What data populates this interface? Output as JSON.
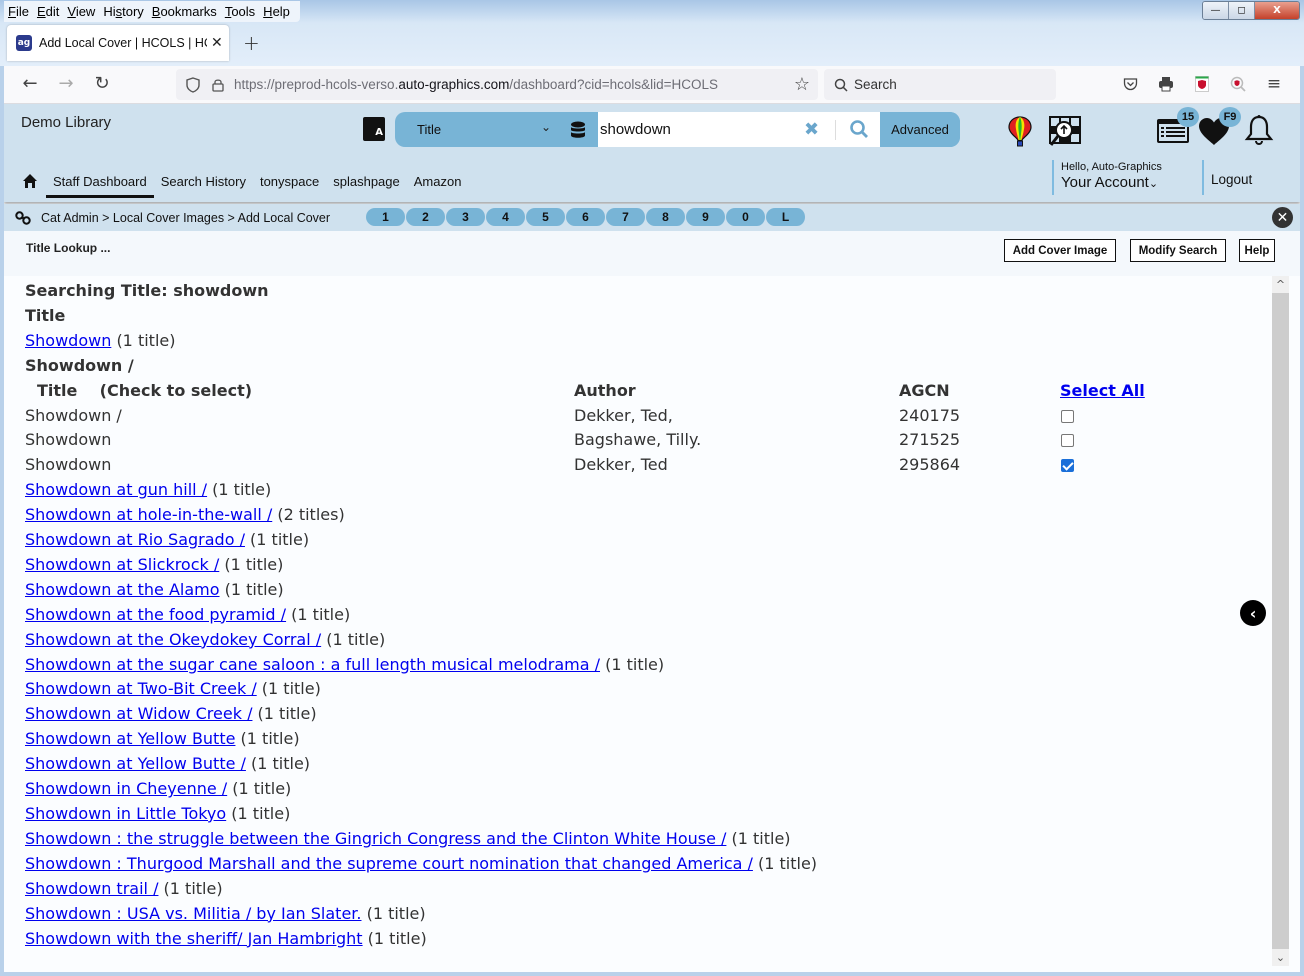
{
  "browser": {
    "menu": [
      "File",
      "Edit",
      "View",
      "History",
      "Bookmarks",
      "Tools",
      "Help"
    ],
    "menu_accel": [
      "F",
      "E",
      "V",
      "s",
      "B",
      "T",
      "H"
    ],
    "tab_title": "Add Local Cover | HCOLS | HCOLS",
    "favicon_text": "ag",
    "url_prefix": "https://preprod-hcols-verso.",
    "url_host": "auto-graphics.com",
    "url_suffix": "/dashboard?cid=hcols&lid=HCOLS",
    "search_placeholder": "Search",
    "window_controls": {
      "minimize": "—",
      "restore": "◻",
      "close": "X"
    }
  },
  "header": {
    "library_name": "Demo Library",
    "search": {
      "type": "Title",
      "query": "showdown",
      "advanced_label": "Advanced"
    },
    "badges": {
      "list_count": "15",
      "favorites": "F9"
    },
    "nav": [
      "Staff Dashboard",
      "Search History",
      "tonyspace",
      "splashpage",
      "Amazon"
    ],
    "active_nav": "Staff Dashboard",
    "greeting": "Hello, Auto-Graphics",
    "account_label": "Your Account",
    "logout_label": "Logout"
  },
  "breadcrumb": {
    "text": "Cat Admin > Local Cover Images > Add Local Cover",
    "quick_tabs": [
      "1",
      "2",
      "3",
      "4",
      "5",
      "6",
      "7",
      "8",
      "9",
      "0",
      "L"
    ]
  },
  "toolbar": {
    "title": "Title Lookup ...",
    "add_cover_label": "Add Cover Image",
    "modify_search_label": "Modify Search",
    "help_label": "Help"
  },
  "results": {
    "searching": "Searching Title: showdown",
    "section_heading": "Title",
    "first_entry": {
      "title": "Showdown",
      "count": "(1 title)"
    },
    "group_heading": "Showdown /",
    "table": {
      "headers": {
        "title": "Title",
        "check_hint": "(Check to select)",
        "author": "Author",
        "agcn": "AGCN",
        "select_all": "Select All"
      },
      "rows": [
        {
          "title": "Showdown /",
          "author": "Dekker, Ted,",
          "agcn": "240175",
          "checked": false
        },
        {
          "title": "Showdown",
          "author": "Bagshawe, Tilly.",
          "agcn": "271525",
          "checked": false
        },
        {
          "title": "Showdown",
          "author": "Dekker, Ted",
          "agcn": "295864",
          "checked": true
        }
      ]
    },
    "entries": [
      {
        "title": "Showdown at gun hill /",
        "count": "(1 title)"
      },
      {
        "title": "Showdown at hole-in-the-wall /",
        "count": "(2 titles)"
      },
      {
        "title": "Showdown at Rio Sagrado /",
        "count": "(1 title)"
      },
      {
        "title": "Showdown at Slickrock /",
        "count": "(1 title)"
      },
      {
        "title": "Showdown at the Alamo",
        "count": "(1 title)"
      },
      {
        "title": "Showdown at the food pyramid /",
        "count": "(1 title)"
      },
      {
        "title": "Showdown at the Okeydokey Corral /",
        "count": "(1 title)"
      },
      {
        "title": "Showdown at the sugar cane saloon : a full length musical melodrama /",
        "count": "(1 title)"
      },
      {
        "title": "Showdown at Two-Bit Creek /",
        "count": "(1 title)"
      },
      {
        "title": "Showdown at Widow Creek /",
        "count": "(1 title)"
      },
      {
        "title": "Showdown at Yellow Butte",
        "count": "(1 title)"
      },
      {
        "title": "Showdown at Yellow Butte /",
        "count": "(1 title)"
      },
      {
        "title": "Showdown in Cheyenne /",
        "count": "(1 title)"
      },
      {
        "title": "Showdown in Little Tokyo",
        "count": "(1 title)"
      },
      {
        "title": "Showdown : the struggle between the Gingrich Congress and the Clinton White House /",
        "count": "(1 title)"
      },
      {
        "title": "Showdown : Thurgood Marshall and the supreme court nomination that changed America /",
        "count": "(1 title)"
      },
      {
        "title": "Showdown trail /",
        "count": "(1 title)"
      },
      {
        "title": "Showdown : USA vs. Militia / by Ian Slater.",
        "count": "(1 title)"
      },
      {
        "title": "Showdown with the sheriff/ Jan Hambright",
        "count": "(1 title)"
      }
    ]
  },
  "colors": {
    "header_bg": "#cfe1ee",
    "accent": "#78b4d6",
    "link": "#0000ee",
    "checkbox_on": "#1a6fd9"
  }
}
